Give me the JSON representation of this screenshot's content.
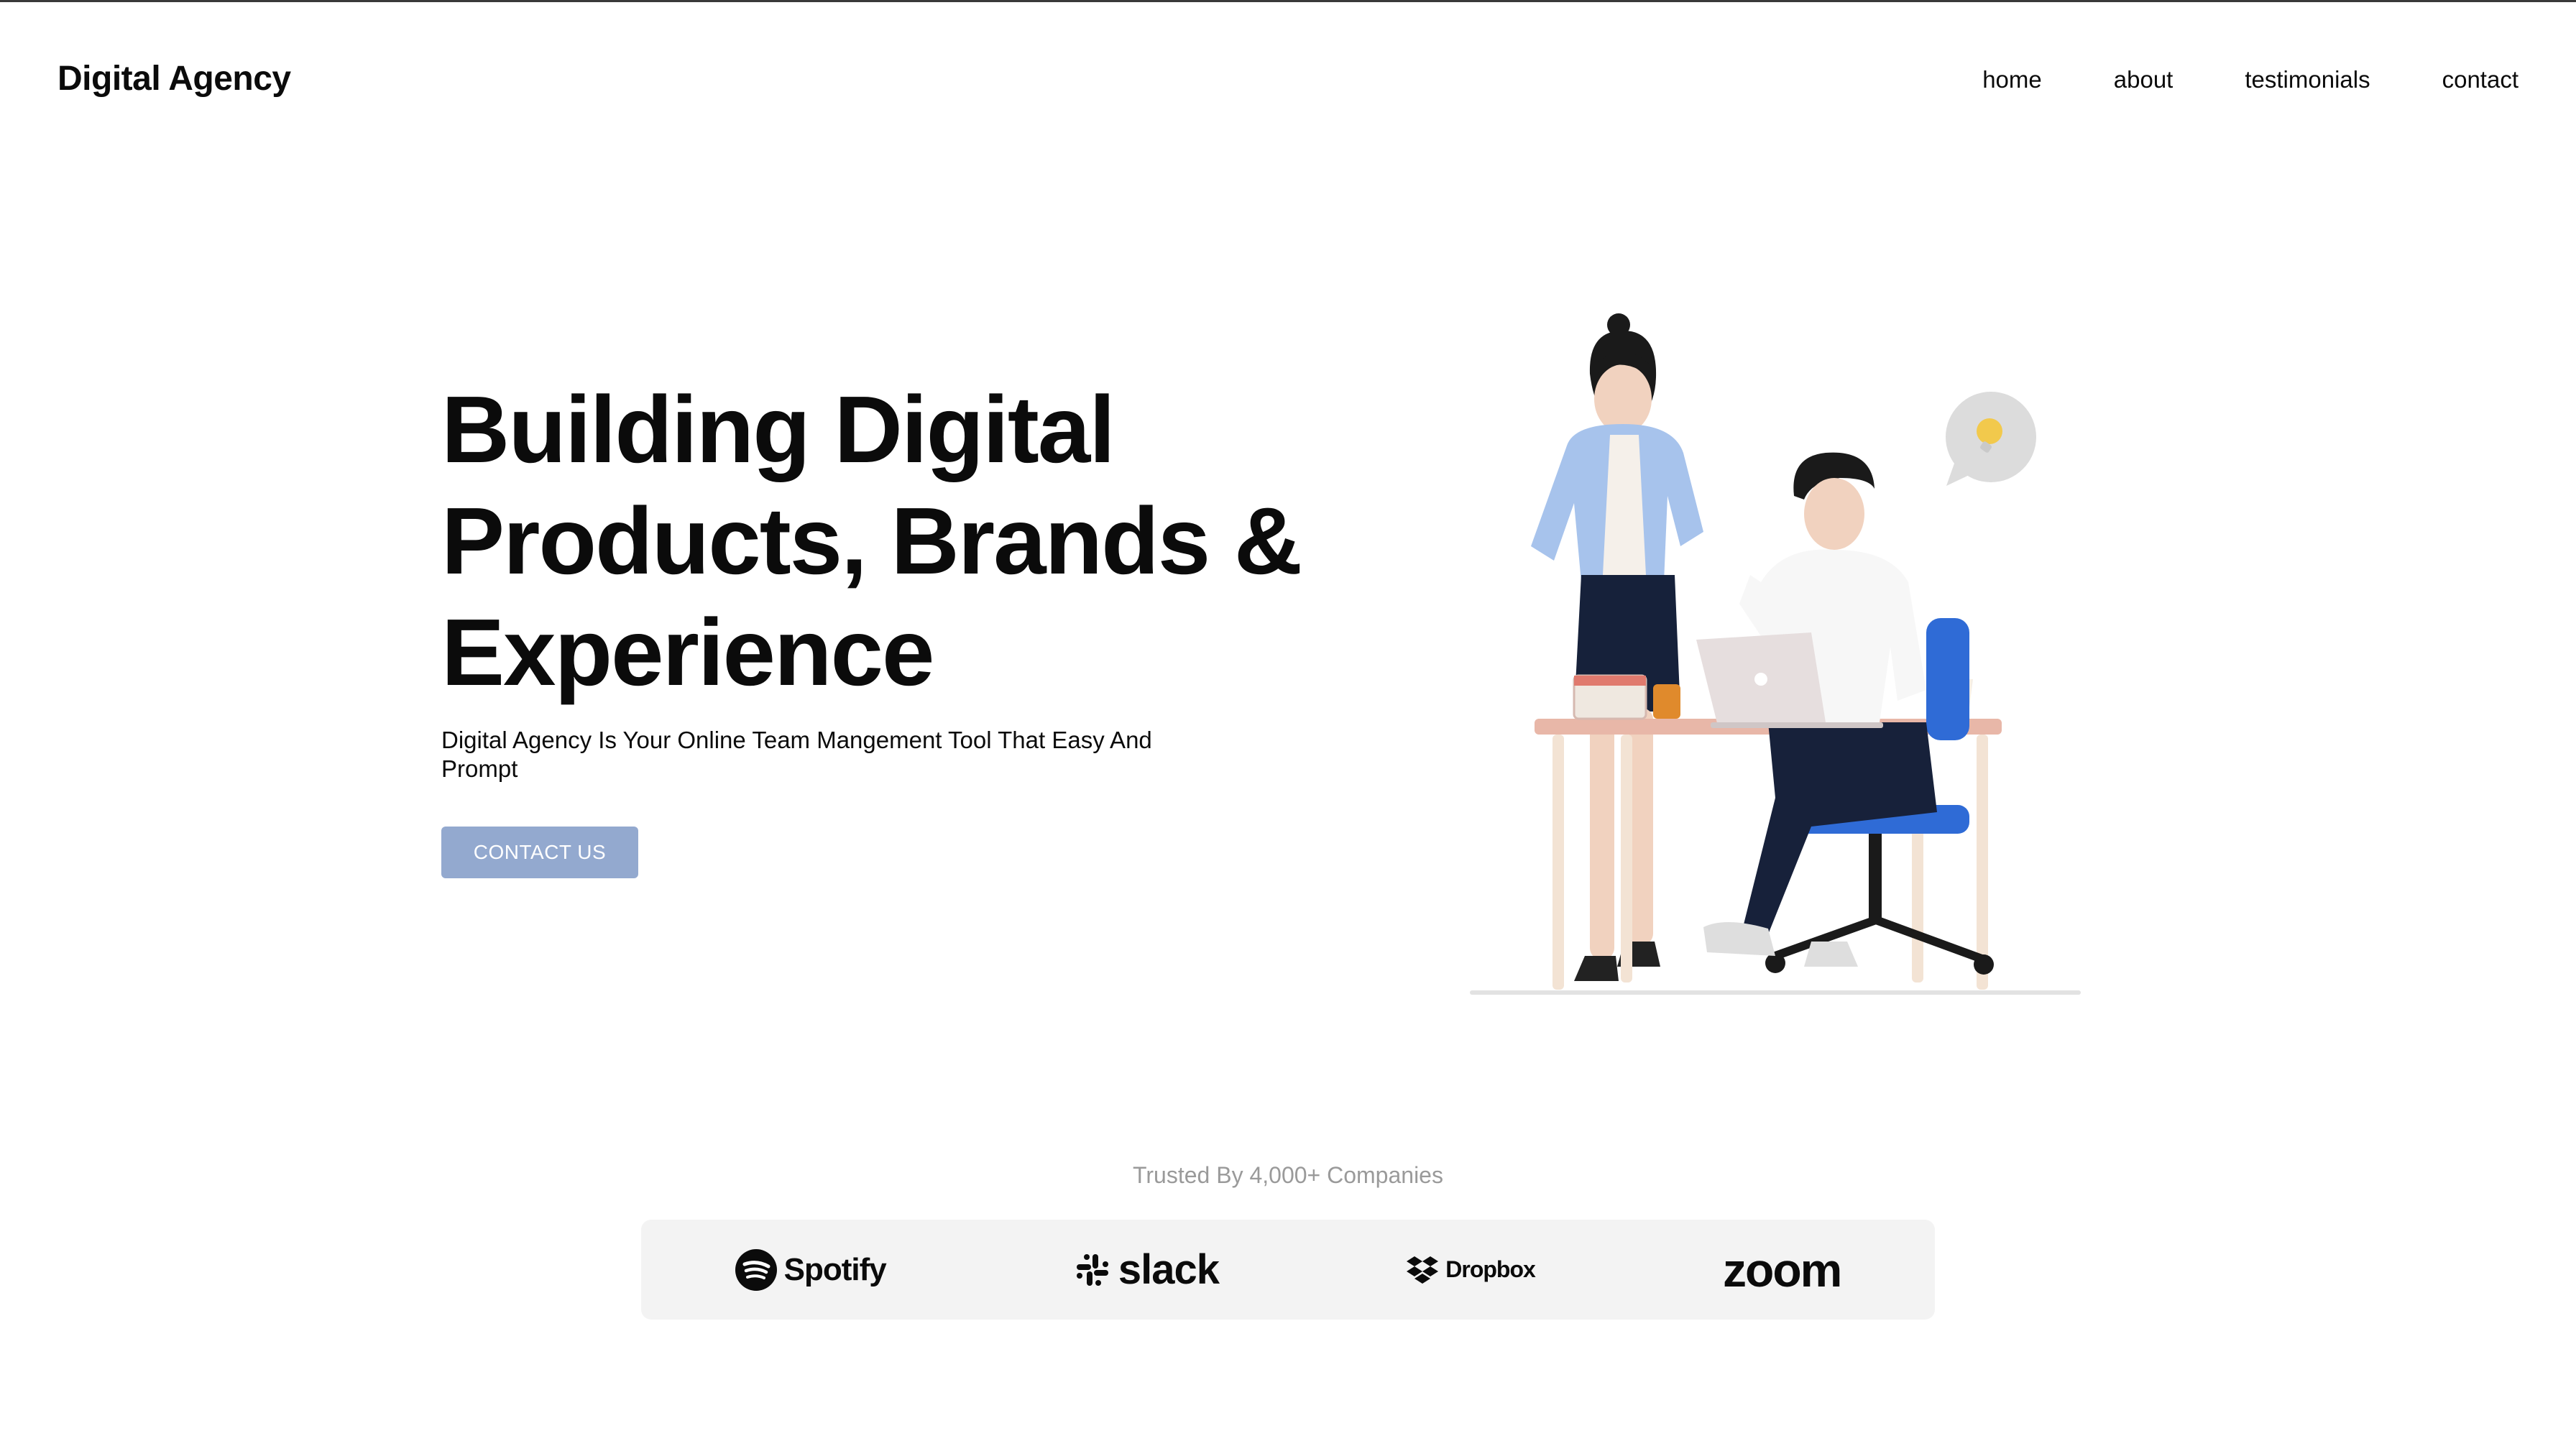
{
  "header": {
    "brand": "Digital Agency",
    "nav": [
      {
        "label": "home"
      },
      {
        "label": "about"
      },
      {
        "label": "testimonials"
      },
      {
        "label": "contact"
      }
    ]
  },
  "hero": {
    "title_lines": [
      "Building Digital",
      "Products, Brands &",
      "Experience"
    ],
    "subtitle": "Digital Agency Is Your Online Team Mangement Tool That Easy And Prompt",
    "cta_label": "CONTACT US",
    "cta_color": "#93a9cf",
    "illustration_icon": "office-team-illustration"
  },
  "trusted": {
    "heading": "Trusted By 4,000+ Companies",
    "logos": [
      {
        "name": "Spotify",
        "icon": "spotify-icon"
      },
      {
        "name": "slack",
        "icon": "slack-icon"
      },
      {
        "name": "Dropbox",
        "icon": "dropbox-icon"
      },
      {
        "name": "zoom",
        "icon": "zoom-logo"
      }
    ]
  }
}
